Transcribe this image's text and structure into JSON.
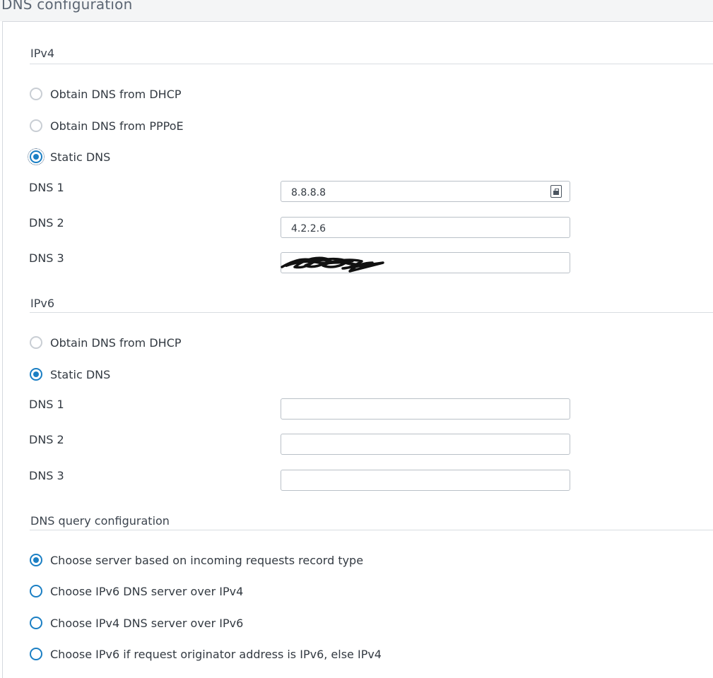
{
  "page": {
    "title": "DNS configuration"
  },
  "ipv4": {
    "section_title": "IPv4",
    "options": [
      {
        "label": "Obtain DNS from DHCP",
        "selected": false
      },
      {
        "label": "Obtain DNS from PPPoE",
        "selected": false
      },
      {
        "label": "Static DNS",
        "selected": true
      }
    ],
    "fields": [
      {
        "label": "DNS 1",
        "value": "8.8.8.8",
        "icon": "contact-card-icon"
      },
      {
        "label": "DNS 2",
        "value": "4.2.2.6"
      },
      {
        "label": "DNS 3",
        "value": "",
        "redacted": true
      }
    ]
  },
  "ipv6": {
    "section_title": "IPv6",
    "options": [
      {
        "label": "Obtain DNS from DHCP",
        "selected": false
      },
      {
        "label": "Static DNS",
        "selected": true
      }
    ],
    "fields": [
      {
        "label": "DNS 1",
        "value": ""
      },
      {
        "label": "DNS 2",
        "value": ""
      },
      {
        "label": "DNS 3",
        "value": ""
      }
    ]
  },
  "query": {
    "section_title": "DNS query configuration",
    "options": [
      {
        "label": "Choose server based on incoming requests record type",
        "selected": true
      },
      {
        "label": "Choose IPv6 DNS server over IPv4",
        "selected": false
      },
      {
        "label": "Choose IPv4 DNS server over IPv6",
        "selected": false
      },
      {
        "label": "Choose IPv6 if request originator address is IPv6, else IPv4",
        "selected": false
      }
    ]
  },
  "colors": {
    "accent": "#1b7fc4",
    "radio_inactive": "#c9ced4",
    "input_border": "#b9c0c7",
    "title_text": "#5c6673"
  }
}
